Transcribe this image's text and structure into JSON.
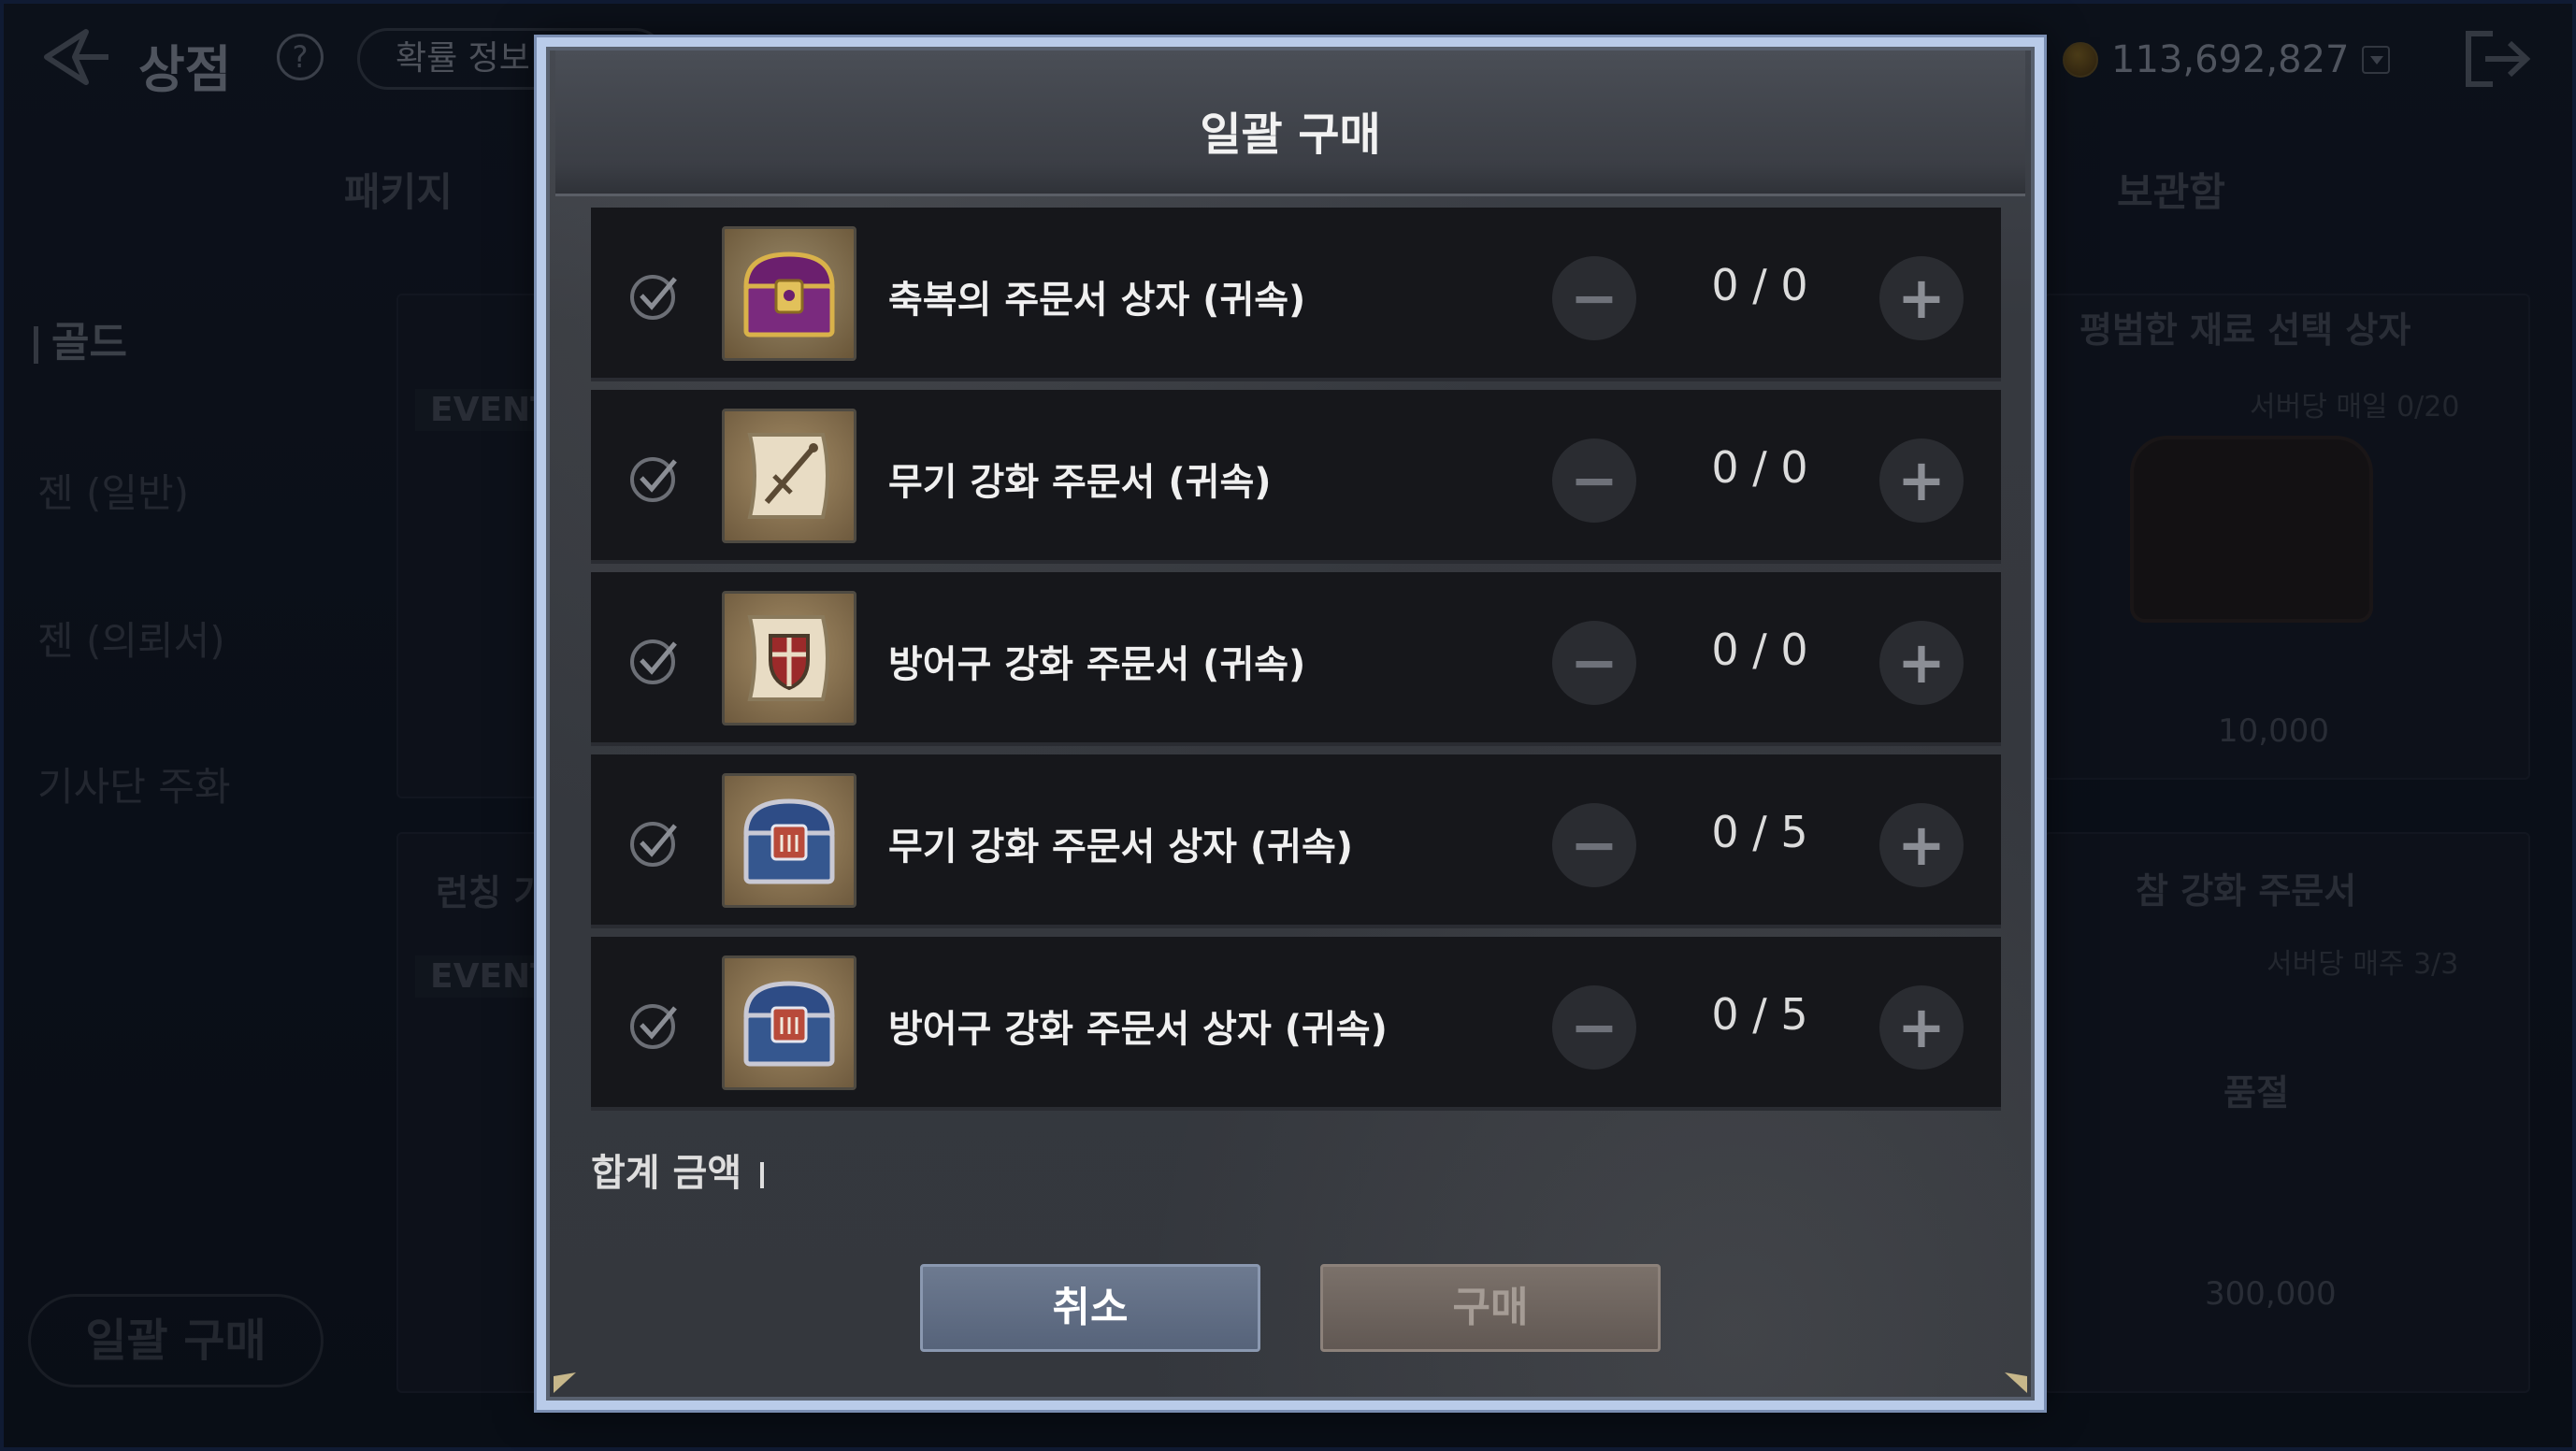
{
  "shop": {
    "title": "상점",
    "help_glyph": "?",
    "probability_button": "확률 정보",
    "gold_amount": "113,692,827",
    "tabs": {
      "package": "패키지",
      "storage": "보관함"
    },
    "sidebar": {
      "gold": "골드",
      "gem_normal": "젠 (일반)",
      "gem_event": "젠 (의뢰서)",
      "knights": "기사단 주화"
    },
    "bulk_purchase_button": "일괄 구매",
    "cards": [
      {
        "event": "EVENT",
        "title": "",
        "sub": "",
        "price": ""
      },
      {
        "event": "EVENT",
        "title": "런칭 기",
        "sub": "",
        "price": ""
      },
      {
        "event": "",
        "title": "평범한 재료 선택 상자",
        "sub": "서버당 매일 0/20",
        "price": "10,000"
      },
      {
        "event": "",
        "title": "참 강화 주문서",
        "sub": "서버당 매주 3/3",
        "price": "300,000",
        "soldout": "품절"
      }
    ]
  },
  "modal": {
    "title": "일괄 구매",
    "minus_glyph": "−",
    "plus_glyph": "+",
    "items": [
      {
        "name": "축복의 주문서 상자 (귀속)",
        "qty": "0 / 0",
        "icon": "blessed-scroll-chest-icon"
      },
      {
        "name": "무기 강화 주문서 (귀속)",
        "qty": "0 / 0",
        "icon": "weapon-scroll-icon"
      },
      {
        "name": "방어구 강화 주문서 (귀속)",
        "qty": "0 / 0",
        "icon": "armor-scroll-icon"
      },
      {
        "name": "무기 강화 주문서 상자 (귀속)",
        "qty": "0 / 5",
        "icon": "weapon-scroll-chest-icon"
      },
      {
        "name": "방어구 강화 주문서 상자 (귀속)",
        "qty": "0 / 5",
        "icon": "armor-scroll-chest-icon"
      }
    ],
    "total_label": "합계 금액",
    "cancel_label": "취소",
    "buy_label": "구매"
  },
  "colors": {
    "modal_border": "#b9cbe9",
    "cancel_button": "#6d7a90",
    "buy_button_disabled": "#7b716a",
    "row_background": "#16171b"
  }
}
